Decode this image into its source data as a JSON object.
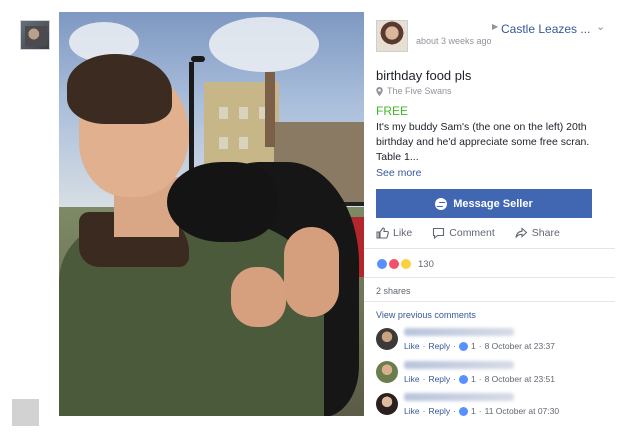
{
  "seller": {
    "name": "Castle Leazes ...",
    "posted": "about 3 weeks ago"
  },
  "listing": {
    "title": "birthday food pls",
    "location": "The Five Swans",
    "price": "FREE",
    "description": "It's my buddy Sam's (the one on the left) 20th birthday and he'd appreciate some free scran. Table 1...",
    "see_more": "See more",
    "message_button": "Message Seller"
  },
  "actions": {
    "like": "Like",
    "comment": "Comment",
    "share": "Share"
  },
  "reactions": {
    "count": "130",
    "types": [
      "like-icon",
      "love-icon",
      "haha-icon"
    ]
  },
  "shares": "2 shares",
  "view_previous": "View previous comments",
  "comments": [
    {
      "like": "Like",
      "reply": "Reply",
      "reactions": "1",
      "time": "8 October at 23:37"
    },
    {
      "like": "Like",
      "reply": "Reply",
      "reactions": "1",
      "time": "8 October at 23:51"
    },
    {
      "like": "Like",
      "reply": "Reply",
      "reactions": "1",
      "time": "11 October at 07:30"
    }
  ],
  "colors": {
    "accent": "#4267b2",
    "link": "#365899",
    "price": "#42b72a",
    "muted": "#90949c"
  }
}
